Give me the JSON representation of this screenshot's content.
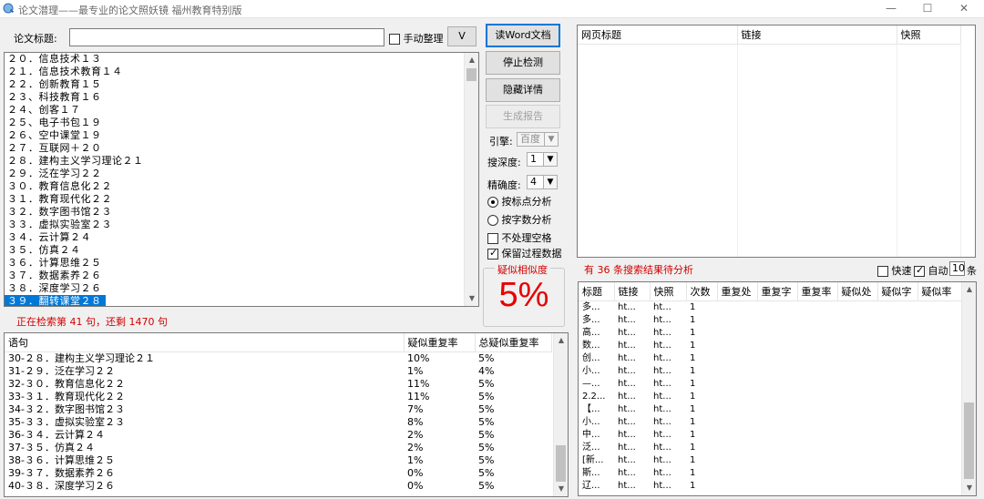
{
  "window": {
    "title": "论文潜理——最专业的论文照妖镜 福州教育特别版",
    "minimize": "—",
    "maximize": "☐",
    "close": "✕"
  },
  "top": {
    "title_label": "论文标题:",
    "title_value": "",
    "manual_label": "手动整理",
    "manual_checked": false,
    "expand_btn": "V"
  },
  "sentences": [
    "２０．信息技术１３",
    "２１．信息技术教育１４",
    "２２．创新教育１５",
    "２３、科技教育１６",
    "２４、创客１７",
    "２５、电子书包１９",
    "２６、空中课堂１９",
    "２７．互联网＋２０",
    "２８．建构主义学习理论２１",
    "２９．泛在学习２２",
    "３０．教育信息化２２",
    "３１．教育现代化２２",
    "３２．数字图书馆２３",
    "３３．虚拟实验室２３",
    "３４．云计算２４",
    "３５．仿真２４",
    "３６．计算思维２５",
    "３７．数据素养２６",
    "３８．深度学习２６",
    "３９．翻转课堂２８"
  ],
  "selected_index": 19,
  "status": "正在检索第 41 句，还剩 1470 句",
  "controls": {
    "read_word": "读Word文档",
    "stop": "停止检测",
    "hide_detail": "隐藏详情",
    "gen_report": "生成报告",
    "engine_label": "引擎:",
    "engine_value": "百度",
    "depth_label": "搜深度:",
    "depth_value": "1",
    "precision_label": "精确度:",
    "precision_value": "4",
    "radio_punct": "按标点分析",
    "radio_chars": "按字数分析",
    "no_space": "不处理空格",
    "keep_data": "保留过程数据",
    "similarity_caption": "疑似相似度",
    "similarity_value": "5%"
  },
  "web_table": {
    "headers": [
      "网页标题",
      "链接",
      "快照"
    ]
  },
  "result_count": "有 36 条搜索结果待分析",
  "fast": {
    "fast_label": "快速",
    "auto_label": "自动",
    "auto_value": "10",
    "unit": "条"
  },
  "search_table": {
    "headers": [
      "标题",
      "链接",
      "快照",
      "次数",
      "重复处",
      "重复字",
      "重复率",
      "疑似处",
      "疑似字",
      "疑似率"
    ],
    "rows": [
      [
        "多...",
        "ht...",
        "ht...",
        "1"
      ],
      [
        "多...",
        "ht...",
        "ht...",
        "1"
      ],
      [
        "高...",
        "ht...",
        "ht...",
        "1"
      ],
      [
        "数...",
        "ht...",
        "ht...",
        "1"
      ],
      [
        "创...",
        "ht...",
        "ht...",
        "1"
      ],
      [
        "小...",
        "ht...",
        "ht...",
        "1"
      ],
      [
        "—...",
        "ht...",
        "ht...",
        "1"
      ],
      [
        "2.2...",
        "ht...",
        "ht...",
        "1"
      ],
      [
        "【...",
        "ht...",
        "ht...",
        "1"
      ],
      [
        "小...",
        "ht...",
        "ht...",
        "1"
      ],
      [
        "中...",
        "ht...",
        "ht...",
        "1"
      ],
      [
        "泛...",
        "ht...",
        "ht...",
        "1"
      ],
      [
        "[新...",
        "ht...",
        "ht...",
        "1"
      ],
      [
        "斯...",
        "ht...",
        "ht...",
        "1"
      ],
      [
        "辽...",
        "ht...",
        "ht...",
        "1"
      ]
    ]
  },
  "rate_table": {
    "headers": [
      "语句",
      "疑似重复率",
      "总疑似重复率"
    ],
    "rows": [
      [
        "30-２８．建构主义学习理论２１",
        "10%",
        "5%"
      ],
      [
        "31-２９．泛在学习２２",
        "1%",
        "4%"
      ],
      [
        "32-３０．教育信息化２２",
        "11%",
        "5%"
      ],
      [
        "33-３１．教育现代化２２",
        "11%",
        "5%"
      ],
      [
        "34-３２．数字图书馆２３",
        "7%",
        "5%"
      ],
      [
        "35-３３．虚拟实验室２３",
        "8%",
        "5%"
      ],
      [
        "36-３４．云计算２４",
        "2%",
        "5%"
      ],
      [
        "37-３５．仿真２４",
        "2%",
        "5%"
      ],
      [
        "38-３６．计算思维２５",
        "1%",
        "5%"
      ],
      [
        "39-３７．数据素养２６",
        "0%",
        "5%"
      ],
      [
        "40-３８．深度学习２６",
        "0%",
        "5%"
      ]
    ]
  }
}
